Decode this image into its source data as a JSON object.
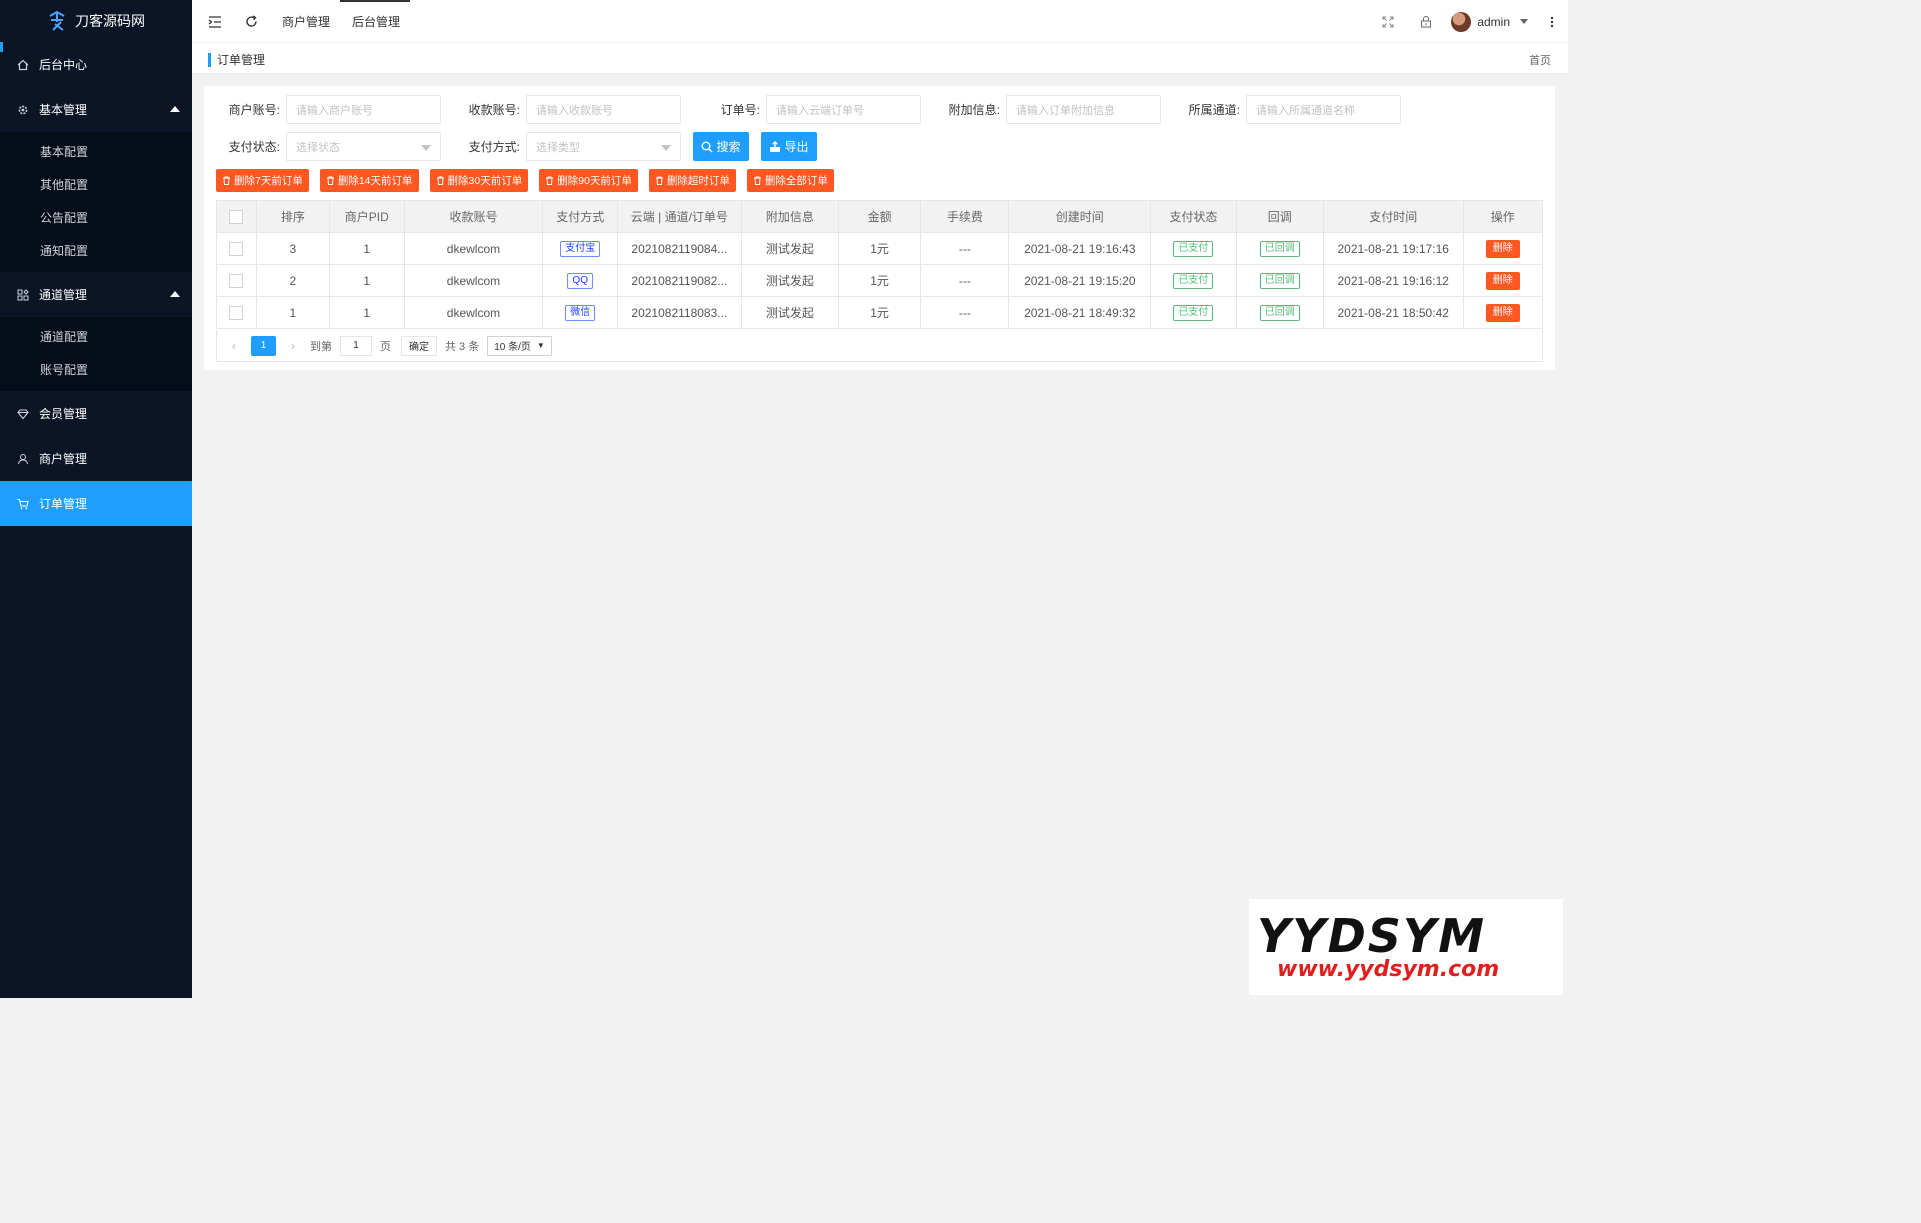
{
  "app": {
    "logo_text": "刀客源码网"
  },
  "sidebar": {
    "items": [
      {
        "label": "后台中心",
        "icon": "home-icon"
      },
      {
        "label": "基本管理",
        "icon": "gear-icon",
        "children": [
          "基本配置",
          "其他配置",
          "公告配置",
          "通知配置"
        ]
      },
      {
        "label": "通道管理",
        "icon": "apps-icon",
        "children": [
          "通道配置",
          "账号配置"
        ]
      },
      {
        "label": "会员管理",
        "icon": "diamond-icon"
      },
      {
        "label": "商户管理",
        "icon": "user-icon"
      },
      {
        "label": "订单管理",
        "icon": "cart-icon",
        "active": true
      }
    ]
  },
  "header": {
    "tabs": [
      "商户管理",
      "后台管理"
    ],
    "active_tab": "后台管理",
    "user": "admin"
  },
  "breadcrumb": {
    "current": "订单管理",
    "home": "首页"
  },
  "filters": {
    "merchant_label": "商户账号:",
    "merchant_placeholder": "请输入商户账号",
    "account_label": "收款账号:",
    "account_placeholder": "请输入收款账号",
    "order_label": "订单号:",
    "order_placeholder": "请输入云端订单号",
    "extra_label": "附加信息:",
    "extra_placeholder": "请输入订单附加信息",
    "channel_label": "所属通道:",
    "channel_placeholder": "请输入所属通道名称",
    "status_label": "支付状态:",
    "status_placeholder": "选择状态",
    "method_label": "支付方式:",
    "method_placeholder": "选择类型",
    "search_label": "搜索",
    "export_label": "导出"
  },
  "delete_buttons": [
    "删除7天前订单",
    "删除14天前订单",
    "删除30天前订单",
    "删除90天前订单",
    "删除超时订单",
    "删除全部订单"
  ],
  "table": {
    "columns": [
      "",
      "排序",
      "商户PID",
      "收款账号",
      "支付方式",
      "云端 | 通道/订单号",
      "附加信息",
      "金额",
      "手续费",
      "创建时间",
      "支付状态",
      "回调",
      "支付时间",
      "操作"
    ],
    "rows": [
      {
        "sort": "3",
        "pid": "1",
        "account": "dkewlcom",
        "method": "支付宝",
        "order": "2021082119084...",
        "extra": "测试发起",
        "amount": "1元",
        "fee": "---",
        "created": "2021-08-21 19:16:43",
        "status": "已支付",
        "callback": "已回调",
        "paid": "2021-08-21 19:17:16",
        "action": "删除"
      },
      {
        "sort": "2",
        "pid": "1",
        "account": "dkewlcom",
        "method": "QQ",
        "order": "2021082119082...",
        "extra": "测试发起",
        "amount": "1元",
        "fee": "---",
        "created": "2021-08-21 19:15:20",
        "status": "已支付",
        "callback": "已回调",
        "paid": "2021-08-21 19:16:12",
        "action": "删除"
      },
      {
        "sort": "1",
        "pid": "1",
        "account": "dkewlcom",
        "method": "微信",
        "order": "2021082118083...",
        "extra": "测试发起",
        "amount": "1元",
        "fee": "---",
        "created": "2021-08-21 18:49:32",
        "status": "已支付",
        "callback": "已回调",
        "paid": "2021-08-21 18:50:42",
        "action": "删除"
      }
    ]
  },
  "pager": {
    "current": "1",
    "goto_label": "到第",
    "goto_value": "1",
    "page_label": "页",
    "confirm_label": "确定",
    "total_label": "共 3 条",
    "page_size": "10 条/页"
  },
  "watermark": {
    "brand": "YYDSYM",
    "url": "www.yydsym.com"
  },
  "colors": {
    "sidebar_bg": "#0b1525",
    "accent": "#1E9FFF",
    "danger": "#FF5722",
    "success": "#5FB878"
  }
}
